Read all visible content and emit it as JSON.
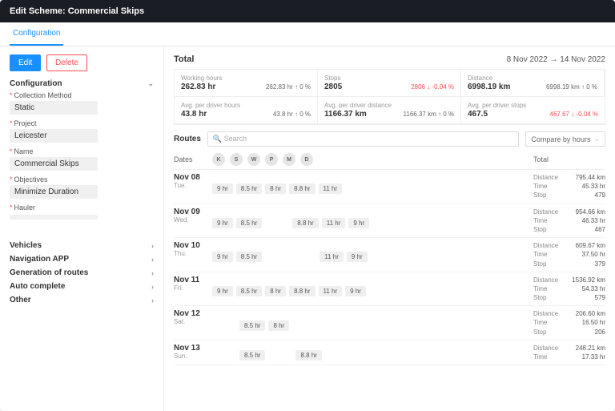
{
  "header": {
    "title": "Edit Scheme: Commercial Skips"
  },
  "tabs": {
    "active": "Configuration"
  },
  "sidebar": {
    "edit": "Edit",
    "delete": "Delete",
    "sections": {
      "configuration": "Configuration",
      "vehicles": "Vehicles",
      "navigation": "Navigation APP",
      "generation": "Generation of routes",
      "autocomplete": "Auto complete",
      "other": "Other"
    },
    "fields": {
      "collection_method": {
        "label": "Collection Method",
        "value": "Static"
      },
      "project": {
        "label": "Project",
        "value": "Leicester"
      },
      "name": {
        "label": "Name",
        "value": "Commercial Skips"
      },
      "objectives": {
        "label": "Objectives",
        "value": "Minimize Duration"
      },
      "hauler": {
        "label": "Hauler",
        "value": ""
      }
    }
  },
  "total": {
    "title": "Total",
    "date_range": "8 Nov 2022 → 14 Nov 2022",
    "metrics": [
      {
        "label": "Working hours",
        "value": "262.83 hr",
        "trend": "262.83 hr ↑ 0 %",
        "color": "normal"
      },
      {
        "label": "Stops",
        "value": "2805",
        "trend": "2806 ↓ -0.04 %",
        "color": "down"
      },
      {
        "label": "Distance",
        "value": "6998.19 km",
        "trend": "6998.19 km ↑ 0 %",
        "color": "normal"
      },
      {
        "label": "Avg. per driver hours",
        "value": "43.8 hr",
        "trend": "43.8 hr ↑ 0 %",
        "color": "normal"
      },
      {
        "label": "Avg. per driver distance",
        "value": "1166.37 km",
        "trend": "1166.37 km ↑ 0 %",
        "color": "normal"
      },
      {
        "label": "Avg. per driver stops",
        "value": "467.5",
        "trend": "467.67 ↓ -0.04 %",
        "color": "down"
      }
    ]
  },
  "routes": {
    "label": "Routes",
    "search_placeholder": "Search",
    "compare": "Compare by hours",
    "columns": {
      "dates": "Dates",
      "total": "Total"
    },
    "driver_initials": [
      "K",
      "S",
      "W",
      "P",
      "M",
      "D"
    ]
  },
  "days": [
    {
      "date": "Nov 08",
      "dow": "Tue.",
      "hours": [
        "9 hr",
        "8.5 hr",
        "8 hr",
        "8.8 hr",
        "11 hr",
        ""
      ],
      "totals": {
        "distance": "795.44 km",
        "time": "45.33 hr",
        "stop": "479"
      }
    },
    {
      "date": "Nov 09",
      "dow": "Wed.",
      "hours": [
        "9 hr",
        "8.5 hr",
        "",
        "8.8 hr",
        "11 hr",
        "9 hr"
      ],
      "totals": {
        "distance": "954.66 km",
        "time": "46.33 hr",
        "stop": "467"
      }
    },
    {
      "date": "Nov 10",
      "dow": "Thu.",
      "hours": [
        "9 hr",
        "8.5 hr",
        "",
        "",
        "11 hr",
        "9 hr"
      ],
      "totals": {
        "distance": "609.67 km",
        "time": "37.50 hr",
        "stop": "379"
      }
    },
    {
      "date": "Nov 11",
      "dow": "Fri.",
      "hours": [
        "9 hr",
        "8.5 hr",
        "8 hr",
        "8.8 hr",
        "11 hr",
        "9 hr"
      ],
      "totals": {
        "distance": "1536.92 km",
        "time": "54.33 hr",
        "stop": "579"
      }
    },
    {
      "date": "Nov 12",
      "dow": "Sat.",
      "hours": [
        "",
        "8.5 hr",
        "8 hr",
        "",
        "",
        ""
      ],
      "totals": {
        "distance": "206.60 km",
        "time": "16.50 hr",
        "stop": "206"
      }
    },
    {
      "date": "Nov 13",
      "dow": "Sun.",
      "hours": [
        "",
        "8.5 hr",
        "",
        "8.8 hr",
        "",
        ""
      ],
      "totals": {
        "distance": "248.21 km",
        "time": "17.33 hr",
        "stop": ""
      }
    }
  ],
  "labels": {
    "distance": "Distance",
    "time": "Time",
    "stop": "Stop"
  }
}
